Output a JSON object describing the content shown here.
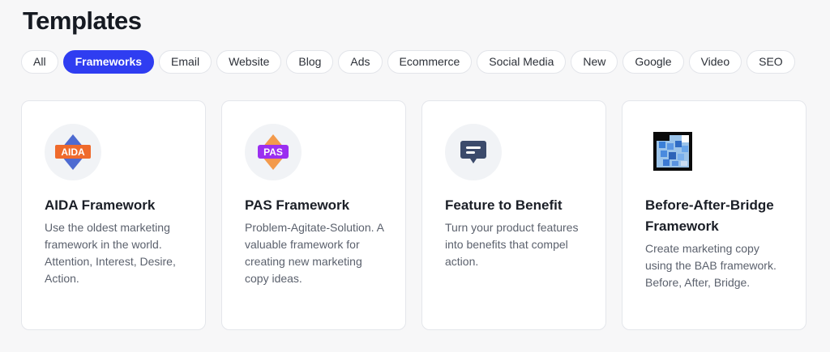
{
  "page": {
    "title": "Templates"
  },
  "tabs": [
    {
      "label": "All",
      "active": false
    },
    {
      "label": "Frameworks",
      "active": true
    },
    {
      "label": "Email",
      "active": false
    },
    {
      "label": "Website",
      "active": false
    },
    {
      "label": "Blog",
      "active": false
    },
    {
      "label": "Ads",
      "active": false
    },
    {
      "label": "Ecommerce",
      "active": false
    },
    {
      "label": "Social Media",
      "active": false
    },
    {
      "label": "New",
      "active": false
    },
    {
      "label": "Google",
      "active": false
    },
    {
      "label": "Video",
      "active": false
    },
    {
      "label": "SEO",
      "active": false
    }
  ],
  "cards": [
    {
      "icon": "aida-logo-icon",
      "icon_text": "AIDA",
      "title": "AIDA Framework",
      "description": "Use the oldest marketing framework in the world. Attention, Interest, Desire, Action."
    },
    {
      "icon": "pas-logo-icon",
      "icon_text": "PAS",
      "title": "PAS Framework",
      "description": "Problem-Agitate-Solution. A valuable framework for creating new marketing copy ideas."
    },
    {
      "icon": "message-bubble-icon",
      "title": "Feature to Benefit",
      "description": "Turn your product features into benefits that compel action."
    },
    {
      "icon": "bridge-image-icon",
      "title": "Before-After-Bridge Framework",
      "description": "Create marketing copy using the BAB framework. Before, After, Bridge."
    }
  ],
  "colors": {
    "accent": "#2f3df1",
    "aida_orange": "#ef6a2c",
    "aida_diamond": "#4e6bd1",
    "pas_purple": "#9b2ff0",
    "pas_diamond": "#f39a4c",
    "message_icon": "#3b4a6b"
  }
}
